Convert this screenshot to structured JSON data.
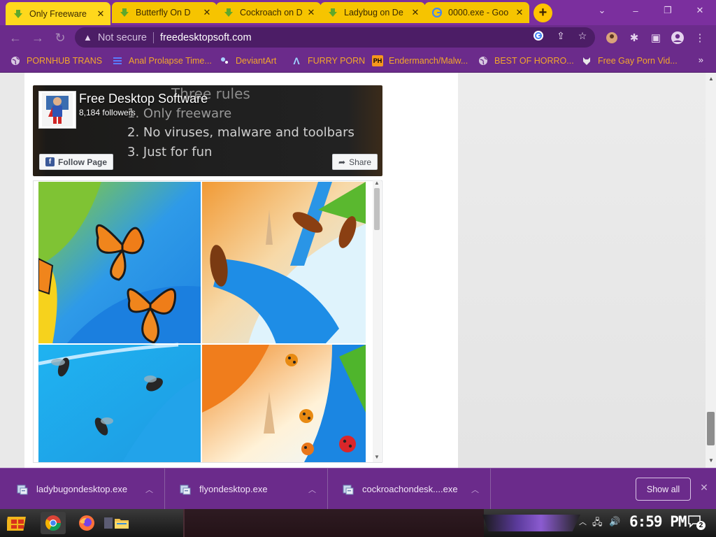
{
  "browser": {
    "tabs": [
      {
        "title": "Only Freeware",
        "icon": "download-arrow-icon",
        "active": true
      },
      {
        "title": "Butterfly On D",
        "icon": "download-arrow-icon",
        "active": false
      },
      {
        "title": "Cockroach on D",
        "icon": "download-arrow-icon",
        "active": false
      },
      {
        "title": "Ladybug on De",
        "icon": "download-arrow-icon",
        "active": false
      },
      {
        "title": "0000.exe - Goo",
        "icon": "google-icon",
        "active": false
      }
    ],
    "new_tab_label": "+",
    "window_controls": {
      "minimize": "⌄",
      "min": "–",
      "restore": "❐",
      "close": "✕"
    },
    "security_label": "Not secure",
    "url": "freedesktopsoft.com",
    "bookmarks": [
      {
        "label": "PORNHUB TRANS",
        "icon": "globe-icon"
      },
      {
        "label": "Anal Prolapse Time...",
        "icon": "bars-icon"
      },
      {
        "label": "DeviantArt",
        "icon": "deviantart-icon"
      },
      {
        "label": "FURRY PORN",
        "icon": "lambda-icon"
      },
      {
        "label": "Endermanch/Malw...",
        "icon": "ph-icon"
      },
      {
        "label": "BEST OF HORRO...",
        "icon": "globe-icon"
      },
      {
        "label": "Free Gay Porn Vid...",
        "icon": "wolf-icon"
      }
    ],
    "bookmarks_more": "»"
  },
  "facebook_widget": {
    "page_name": "Free Desktop Software",
    "followers": "8,184 followers",
    "follow_label": "Follow Page",
    "share_label": "Share",
    "cover_text": {
      "heading": "Three rules",
      "rule1": "1. Only freeware",
      "rule2": "2. No viruses, malware and toolbars",
      "rule3": "3. Just for fun"
    }
  },
  "downloads": {
    "items": [
      {
        "name": "ladybugondesktop.exe"
      },
      {
        "name": "flyondesktop.exe"
      },
      {
        "name": "cockroachondesk....exe"
      }
    ],
    "show_all_label": "Show all",
    "close_label": "✕"
  },
  "taskbar": {
    "clock": "6:59 PM",
    "notification_count": "2"
  },
  "colors": {
    "browser_frame": "#6b2b8b",
    "tab_yellow": "#ffd81c",
    "bookmark_text": "#f3a72b"
  }
}
